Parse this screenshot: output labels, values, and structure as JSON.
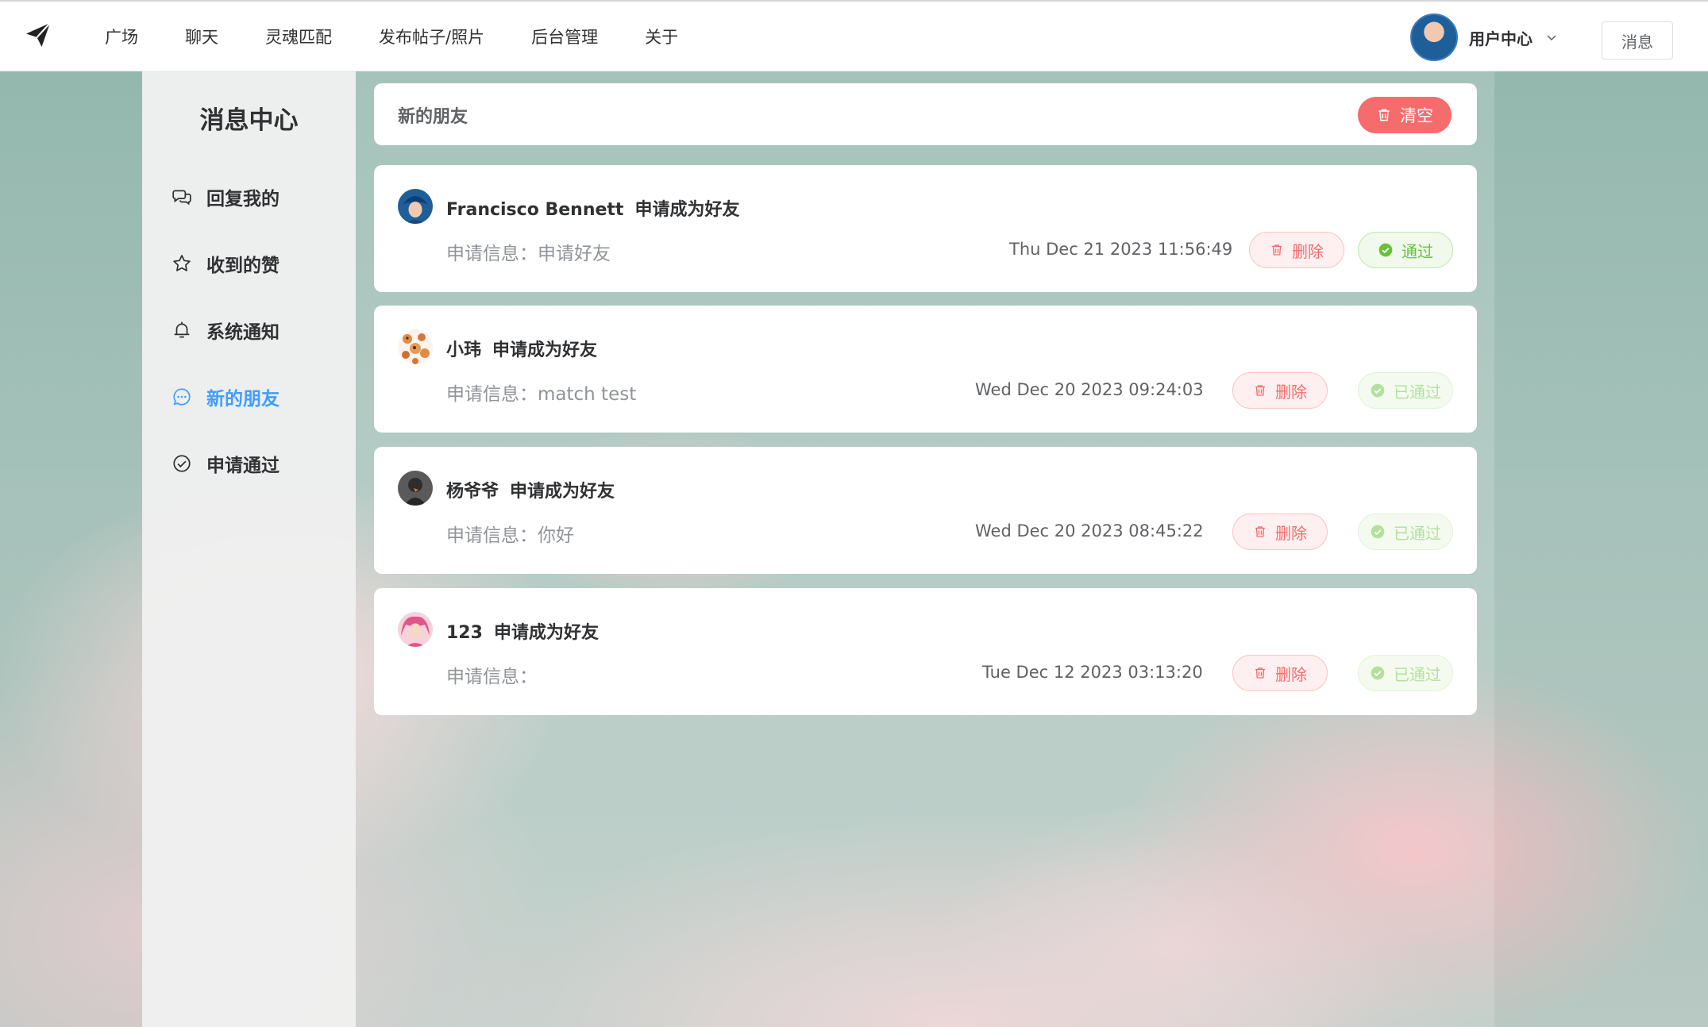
{
  "nav": {
    "items": [
      "广场",
      "聊天",
      "灵魂匹配",
      "发布帖子/照片",
      "后台管理",
      "关于"
    ],
    "user_label": "用户中心",
    "message_button": "消息"
  },
  "sidebar": {
    "title": "消息中心",
    "items": [
      {
        "label": "回复我的",
        "icon": "chat-bubbles-icon"
      },
      {
        "label": "收到的赞",
        "icon": "star-icon"
      },
      {
        "label": "系统通知",
        "icon": "bell-icon"
      },
      {
        "label": "新的朋友",
        "icon": "chat-dots-icon",
        "active": true
      },
      {
        "label": "申请通过",
        "icon": "check-circle-icon"
      }
    ]
  },
  "main": {
    "header_title": "新的朋友",
    "clear_label": "清空",
    "colors": {
      "danger": "#f56c6c",
      "success": "#67c23a",
      "primary": "#409eff"
    },
    "requests": [
      {
        "name": "Francisco Bennett",
        "action": "申请成为好友",
        "message": "申请信息：申请好友",
        "time": "Thu Dec 21 2023 11:56:49",
        "delete_label": "删除",
        "status_label": "通过",
        "approved": false
      },
      {
        "name": "小玮",
        "action": "申请成为好友",
        "message": "申请信息：match test",
        "time": "Wed Dec 20 2023 09:24:03",
        "delete_label": "删除",
        "status_label": "已通过",
        "approved": true
      },
      {
        "name": "杨爷爷",
        "action": "申请成为好友",
        "message": "申请信息：你好",
        "time": "Wed Dec 20 2023 08:45:22",
        "delete_label": "删除",
        "status_label": "已通过",
        "approved": true
      },
      {
        "name": "123",
        "action": "申请成为好友",
        "message": "申请信息：",
        "time": "Tue Dec 12 2023 03:13:20",
        "delete_label": "删除",
        "status_label": "已通过",
        "approved": true
      }
    ]
  }
}
